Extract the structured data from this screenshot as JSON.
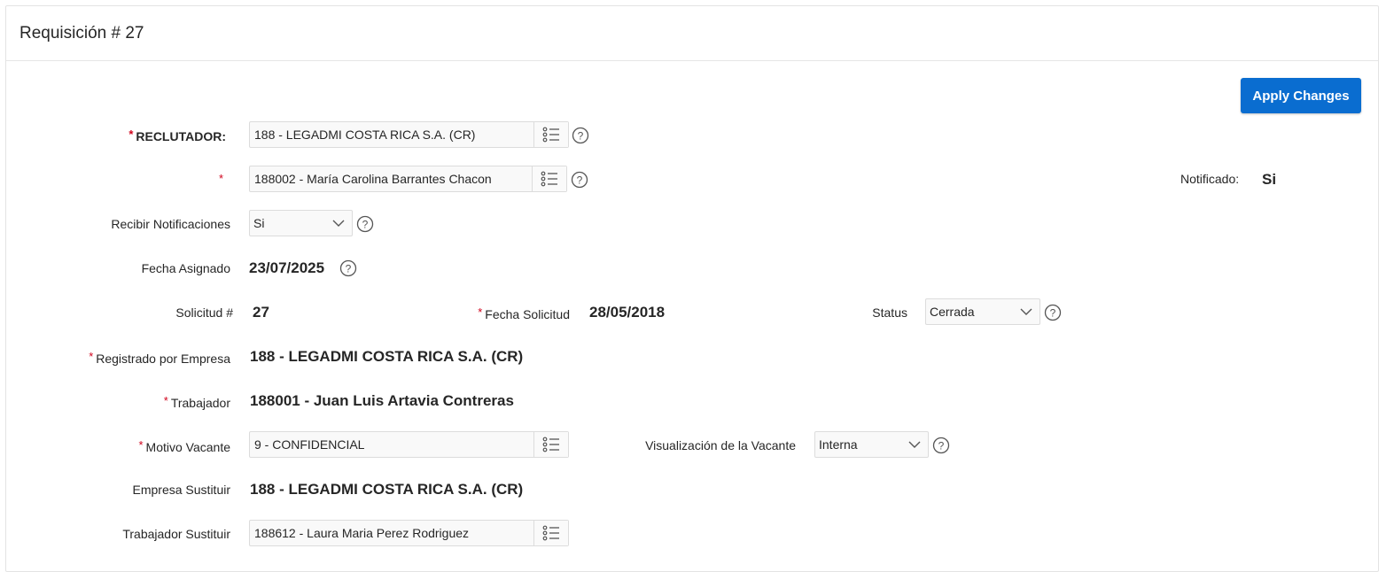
{
  "region": {
    "title": "Requisición # 27",
    "apply_button": "Apply Changes"
  },
  "form": {
    "reclutador": {
      "label": "RECLUTADOR:",
      "required": "*",
      "value": "188 - LEGADMI COSTA RICA S.A. (CR)"
    },
    "reclutador_persona": {
      "required": "*",
      "value": "188002 - María Carolina Barrantes Chacon"
    },
    "notificado": {
      "label": "Notificado:",
      "value": "Si"
    },
    "recibir_notificaciones": {
      "label": "Recibir Notificaciones",
      "value": "Si"
    },
    "fecha_asignado": {
      "label": "Fecha Asignado",
      "value": "23/07/2025"
    },
    "solicitud": {
      "label": "Solicitud #",
      "value": "27"
    },
    "fecha_solicitud": {
      "label": "Fecha Solicitud",
      "required": "*",
      "value": "28/05/2018"
    },
    "status": {
      "label": "Status",
      "value": "Cerrada"
    },
    "registrado_por_empresa": {
      "label": "Registrado por Empresa",
      "required": "*",
      "value": "188 - LEGADMI COSTA RICA S.A. (CR)"
    },
    "trabajador": {
      "label": "Trabajador",
      "required": "*",
      "value": "188001 - Juan Luis Artavia Contreras"
    },
    "motivo_vacante": {
      "label": "Motivo Vacante",
      "required": "*",
      "value": "9 - CONFIDENCIAL"
    },
    "visualizacion_vacante": {
      "label": "Visualización de la Vacante",
      "value": "Interna"
    },
    "empresa_sustituir": {
      "label": "Empresa Sustituir",
      "value": "188 - LEGADMI COSTA RICA S.A. (CR)"
    },
    "trabajador_sustituir": {
      "label": "Trabajador Sustituir",
      "value": "188612 - Laura Maria Perez Rodriguez"
    }
  },
  "icons": {
    "lov": "list-icon",
    "help": "help-icon",
    "select": "chevron-down-icon"
  },
  "colors": {
    "primary_button": "#0a6dd0",
    "required": "#d0021b"
  }
}
